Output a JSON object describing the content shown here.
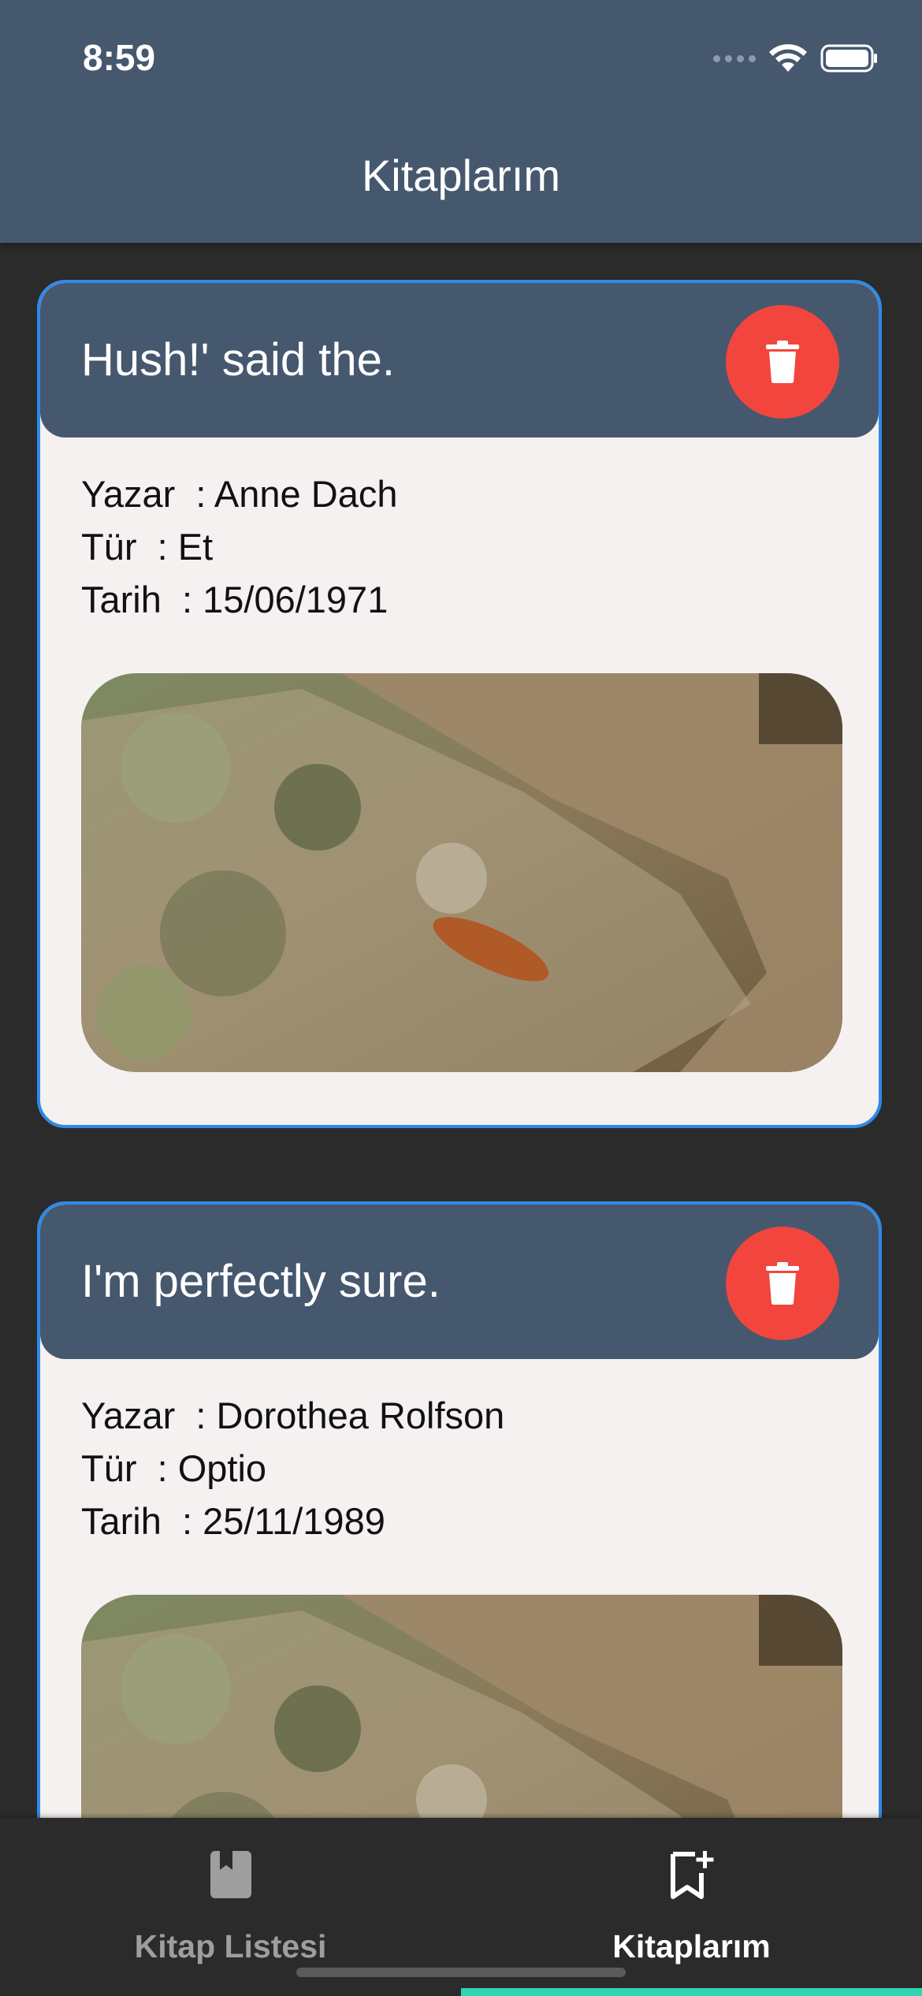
{
  "status_bar": {
    "time": "8:59",
    "signal_icon": "signal-dots-icon",
    "wifi_icon": "wifi-icon",
    "battery_icon": "battery-icon"
  },
  "app_bar": {
    "title": "Kitaplarım"
  },
  "books": [
    {
      "title": "Hush!' said the.",
      "author_line": "Yazar  : Anne Dach",
      "genre_line": "Tür  : Et",
      "date_line": "Tarih  : 15/06/1971",
      "delete_icon": "trash-icon"
    },
    {
      "title": "I'm perfectly sure.",
      "author_line": "Yazar  : Dorothea Rolfson",
      "genre_line": "Tür  : Optio",
      "date_line": "Tarih  : 25/11/1989",
      "delete_icon": "trash-icon"
    }
  ],
  "bottom_nav": {
    "items": [
      {
        "label": "Kitap Listesi",
        "icon": "book-icon",
        "active": false
      },
      {
        "label": "Kitaplarım",
        "icon": "bookmark-add-icon",
        "active": true
      }
    ]
  },
  "colors": {
    "app_bar": "#46586e",
    "background": "#2b2b2b",
    "card_border": "#2f8ae8",
    "card_body": "#f4f1f0",
    "delete_button": "#f2453d",
    "nav_indicator": "#2fd6b0"
  }
}
